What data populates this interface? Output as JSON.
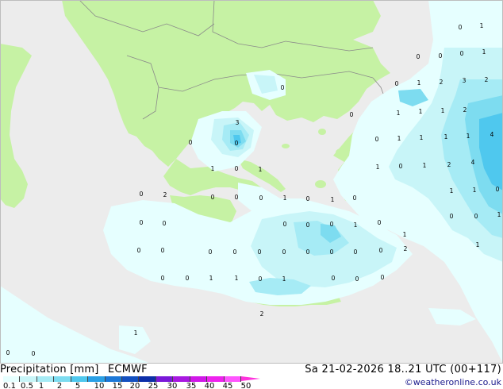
{
  "legend": {
    "title": "Precipitation [mm]",
    "model": "ECMWF",
    "valid_time": "Sa 21-02-2026 18..21 UTC (00+117)",
    "credit": "©weatheronline.co.uk",
    "scale": [
      {
        "label": "0.1",
        "color": "#e6ffff"
      },
      {
        "label": "0.5",
        "color": "#c8f5f8"
      },
      {
        "label": "1",
        "color": "#a6ebf5"
      },
      {
        "label": "2",
        "color": "#7ddcf0"
      },
      {
        "label": "5",
        "color": "#4fc8ee"
      },
      {
        "label": "10",
        "color": "#2aa0e6"
      },
      {
        "label": "15",
        "color": "#1c78d8"
      },
      {
        "label": "20",
        "color": "#1450c0"
      },
      {
        "label": "25",
        "color": "#0c2ea8"
      },
      {
        "label": "30",
        "color": "#7a18d8"
      },
      {
        "label": "35",
        "color": "#a818e0"
      },
      {
        "label": "40",
        "color": "#d018e8"
      },
      {
        "label": "45",
        "color": "#ee22ee"
      },
      {
        "label": "50",
        "color": "#ff55ff"
      }
    ]
  },
  "map": {
    "sea_color": "#ececec",
    "land_color": "#c6f2a4",
    "precip_values": [
      {
        "t": "0"
      },
      {
        "t": "1"
      },
      {
        "t": "0"
      },
      {
        "t": "0"
      },
      {
        "t": "0"
      },
      {
        "t": "1"
      },
      {
        "t": "0"
      },
      {
        "t": "1"
      },
      {
        "t": "2"
      },
      {
        "t": "3"
      },
      {
        "t": "2"
      },
      {
        "t": "0"
      },
      {
        "t": "0"
      },
      {
        "t": "1"
      },
      {
        "t": "1"
      },
      {
        "t": "1"
      },
      {
        "t": "2"
      },
      {
        "t": "3"
      },
      {
        "t": "0"
      },
      {
        "t": "0"
      },
      {
        "t": "1"
      },
      {
        "t": "1"
      },
      {
        "t": "1"
      },
      {
        "t": "1"
      },
      {
        "t": "4"
      },
      {
        "t": "0"
      },
      {
        "t": "1"
      },
      {
        "t": "0"
      },
      {
        "t": "1"
      },
      {
        "t": "1"
      },
      {
        "t": "0"
      },
      {
        "t": "1"
      },
      {
        "t": "2"
      },
      {
        "t": "4"
      },
      {
        "t": "0"
      },
      {
        "t": "2"
      },
      {
        "t": "0"
      },
      {
        "t": "0"
      },
      {
        "t": "0"
      },
      {
        "t": "1"
      },
      {
        "t": "0"
      },
      {
        "t": "1"
      },
      {
        "t": "0"
      },
      {
        "t": "1"
      },
      {
        "t": "1"
      },
      {
        "t": "0"
      },
      {
        "t": "0"
      },
      {
        "t": "0"
      },
      {
        "t": "0"
      },
      {
        "t": "0"
      },
      {
        "t": "0"
      },
      {
        "t": "1"
      },
      {
        "t": "0"
      },
      {
        "t": "0"
      },
      {
        "t": "0"
      },
      {
        "t": "1"
      },
      {
        "t": "0"
      },
      {
        "t": "0"
      },
      {
        "t": "0"
      },
      {
        "t": "0"
      },
      {
        "t": "0"
      },
      {
        "t": "0"
      },
      {
        "t": "0"
      },
      {
        "t": "0"
      },
      {
        "t": "0"
      },
      {
        "t": "0"
      },
      {
        "t": "2"
      },
      {
        "t": "1"
      },
      {
        "t": "0"
      },
      {
        "t": "0"
      },
      {
        "t": "1"
      },
      {
        "t": "1"
      },
      {
        "t": "0"
      },
      {
        "t": "1"
      },
      {
        "t": "0"
      },
      {
        "t": "0"
      },
      {
        "t": "0"
      },
      {
        "t": "1"
      },
      {
        "t": "0"
      },
      {
        "t": "0"
      },
      {
        "t": "2"
      },
      {
        "t": "1"
      }
    ]
  }
}
